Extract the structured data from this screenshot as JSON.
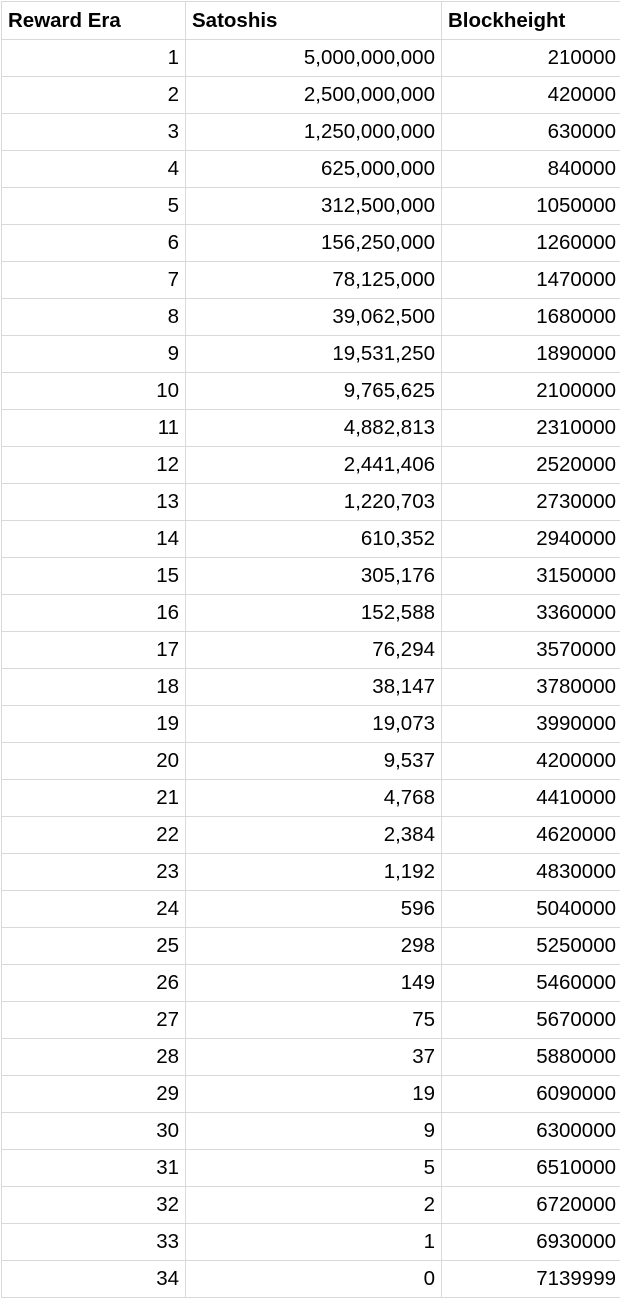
{
  "columns": [
    "Reward Era",
    "Satoshis",
    "Blockheight"
  ],
  "rows": [
    [
      "1",
      "5,000,000,000",
      "210000"
    ],
    [
      "2",
      "2,500,000,000",
      "420000"
    ],
    [
      "3",
      "1,250,000,000",
      "630000"
    ],
    [
      "4",
      "625,000,000",
      "840000"
    ],
    [
      "5",
      "312,500,000",
      "1050000"
    ],
    [
      "6",
      "156,250,000",
      "1260000"
    ],
    [
      "7",
      "78,125,000",
      "1470000"
    ],
    [
      "8",
      "39,062,500",
      "1680000"
    ],
    [
      "9",
      "19,531,250",
      "1890000"
    ],
    [
      "10",
      "9,765,625",
      "2100000"
    ],
    [
      "11",
      "4,882,813",
      "2310000"
    ],
    [
      "12",
      "2,441,406",
      "2520000"
    ],
    [
      "13",
      "1,220,703",
      "2730000"
    ],
    [
      "14",
      "610,352",
      "2940000"
    ],
    [
      "15",
      "305,176",
      "3150000"
    ],
    [
      "16",
      "152,588",
      "3360000"
    ],
    [
      "17",
      "76,294",
      "3570000"
    ],
    [
      "18",
      "38,147",
      "3780000"
    ],
    [
      "19",
      "19,073",
      "3990000"
    ],
    [
      "20",
      "9,537",
      "4200000"
    ],
    [
      "21",
      "4,768",
      "4410000"
    ],
    [
      "22",
      "2,384",
      "4620000"
    ],
    [
      "23",
      "1,192",
      "4830000"
    ],
    [
      "24",
      "596",
      "5040000"
    ],
    [
      "25",
      "298",
      "5250000"
    ],
    [
      "26",
      "149",
      "5460000"
    ],
    [
      "27",
      "75",
      "5670000"
    ],
    [
      "28",
      "37",
      "5880000"
    ],
    [
      "29",
      "19",
      "6090000"
    ],
    [
      "30",
      "9",
      "6300000"
    ],
    [
      "31",
      "5",
      "6510000"
    ],
    [
      "32",
      "2",
      "6720000"
    ],
    [
      "33",
      "1",
      "6930000"
    ],
    [
      "34",
      "0",
      "7139999"
    ]
  ],
  "colors": {
    "gridline": "#d9d9d9",
    "text": "#000000",
    "background": "#ffffff"
  }
}
